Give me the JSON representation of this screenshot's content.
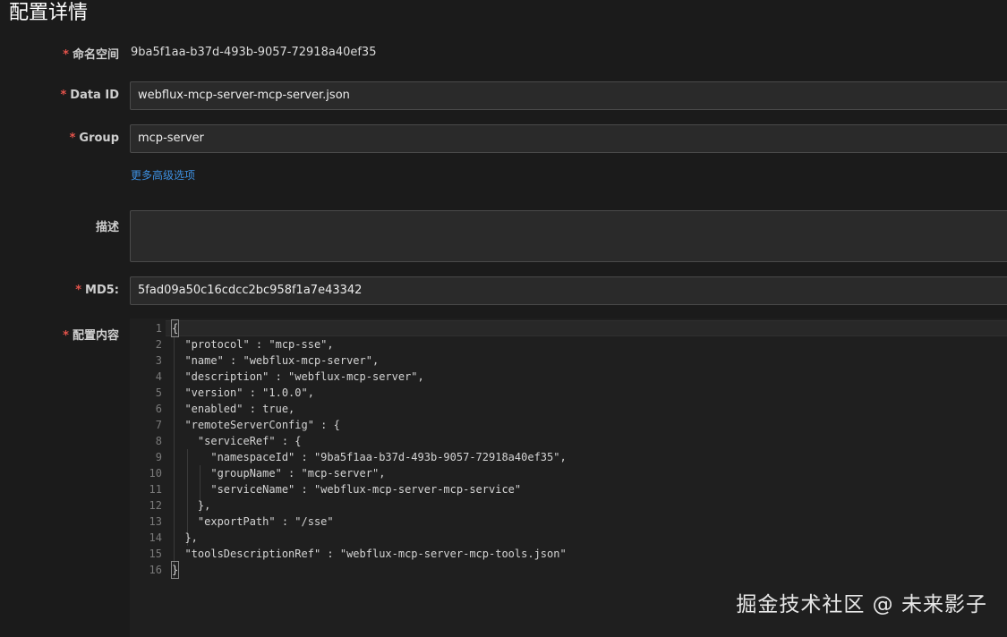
{
  "page": {
    "title": "配置详情"
  },
  "form": {
    "namespace": {
      "required": "*",
      "label": "命名空间",
      "value": "9ba5f1aa-b37d-493b-9057-72918a40ef35"
    },
    "data_id": {
      "required": "*",
      "label": "Data ID",
      "value": "webflux-mcp-server-mcp-server.json"
    },
    "group": {
      "required": "*",
      "label": "Group",
      "value": "mcp-server"
    },
    "advanced_link": "更多高级选项",
    "description": {
      "label": "描述",
      "value": ""
    },
    "md5": {
      "required": "*",
      "label": "MD5:",
      "value": "5fad09a50c16cdcc2bc958f1a7e43342"
    },
    "content": {
      "required": "*",
      "label": "配置内容"
    }
  },
  "editor": {
    "lines": [
      {
        "num": "1",
        "text": "{"
      },
      {
        "num": "2",
        "text": "  \"protocol\" : \"mcp-sse\","
      },
      {
        "num": "3",
        "text": "  \"name\" : \"webflux-mcp-server\","
      },
      {
        "num": "4",
        "text": "  \"description\" : \"webflux-mcp-server\","
      },
      {
        "num": "5",
        "text": "  \"version\" : \"1.0.0\","
      },
      {
        "num": "6",
        "text": "  \"enabled\" : true,"
      },
      {
        "num": "7",
        "text": "  \"remoteServerConfig\" : {"
      },
      {
        "num": "8",
        "text": "    \"serviceRef\" : {"
      },
      {
        "num": "9",
        "text": "      \"namespaceId\" : \"9ba5f1aa-b37d-493b-9057-72918a40ef35\","
      },
      {
        "num": "10",
        "text": "      \"groupName\" : \"mcp-server\","
      },
      {
        "num": "11",
        "text": "      \"serviceName\" : \"webflux-mcp-server-mcp-service\""
      },
      {
        "num": "12",
        "text": "    },"
      },
      {
        "num": "13",
        "text": "    \"exportPath\" : \"/sse\""
      },
      {
        "num": "14",
        "text": "  },"
      },
      {
        "num": "15",
        "text": "  \"toolsDescriptionRef\" : \"webflux-mcp-server-mcp-tools.json\""
      },
      {
        "num": "16",
        "text": "}"
      }
    ]
  },
  "watermark": {
    "text": "掘金技术社区 @ 未来影子"
  },
  "colors": {
    "background": "#1b1b1b",
    "input_bg": "#2a2a2a",
    "required": "#e5534b",
    "link": "#3d8fe0"
  }
}
